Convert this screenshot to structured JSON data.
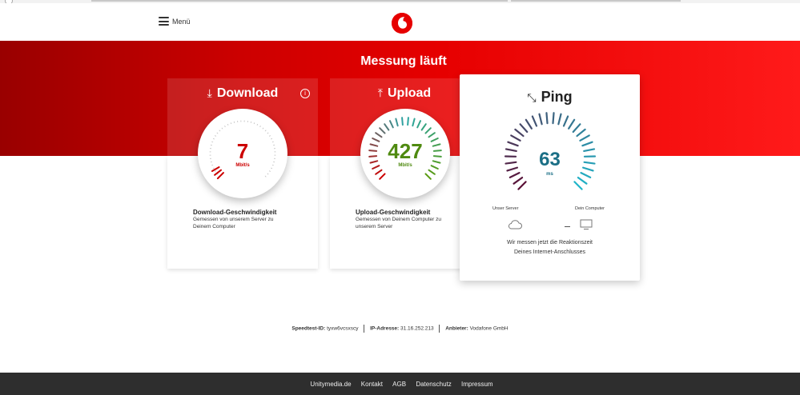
{
  "header": {
    "menu_label": "Menü",
    "brand_color": "#e60000"
  },
  "hero": {
    "title": "Messung läuft"
  },
  "download": {
    "title": "Download",
    "icon": "download-icon",
    "value": "7",
    "unit": "Mbit/s",
    "subtitle": "Download-Geschwindigkeit",
    "description": "Gemessen von unserem Server zu Deinem Computer",
    "value_color": "#cc0000"
  },
  "upload": {
    "title": "Upload",
    "icon": "upload-icon",
    "value": "427",
    "unit": "Mbit/s",
    "subtitle": "Upload-Geschwindigkeit",
    "description": "Gemessen von Deinem Computer zu unserem Server",
    "value_color": "#4f8a10"
  },
  "ping": {
    "title": "Ping",
    "icon": "expand-arrows-icon",
    "value": "63",
    "unit": "ms",
    "server_label": "Unser Server",
    "computer_label": "Dein Computer",
    "message_line1": "Wir messen jetzt die Reaktionszeit",
    "message_line2": "Deines Internet-Anschlusses",
    "value_color": "#1b6f86"
  },
  "info": {
    "speedtest_label": "Speedtest-ID:",
    "speedtest_value": "tyxw6vcsxscy",
    "ip_label": "IP-Adresse:",
    "ip_value": "31.16.252.213",
    "provider_label": "Anbieter:",
    "provider_value": "Vodafone GmbH"
  },
  "footer": {
    "links": [
      "Unitymedia.de",
      "Kontakt",
      "AGB",
      "Datenschutz",
      "Impressum"
    ]
  }
}
